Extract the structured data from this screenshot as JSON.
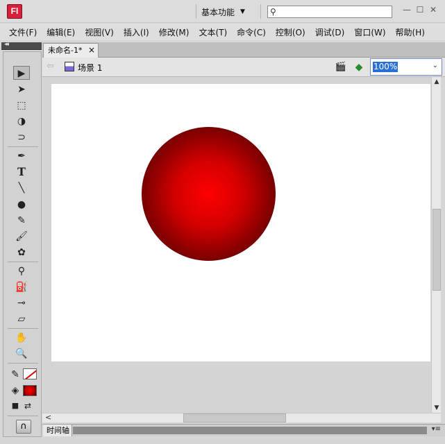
{
  "app": {
    "logo": "Fl",
    "workspace_label": "基本功能",
    "workspace_caret": "▼",
    "search_icon": "⚲",
    "minimize": "—",
    "maximize": "☐",
    "close": "✕"
  },
  "menu": [
    "文件(F)",
    "编辑(E)",
    "视图(V)",
    "插入(I)",
    "修改(M)",
    "文本(T)",
    "命令(C)",
    "控制(O)",
    "调试(D)",
    "窗口(W)",
    "帮助(H)"
  ],
  "tools_panel": {
    "collapse": "◂◂",
    "icons": {
      "selection": "▶",
      "subselection": "➤",
      "free_transform": "⬚",
      "3d_rotation": "◑",
      "lasso": "⊃",
      "pen": "✒",
      "text": "T",
      "line": "╲",
      "oval": "●",
      "pencil": "✎",
      "brush": "🖌",
      "deco": "✿",
      "bone": "⚲",
      "paint_bucket": "⛽",
      "eyedropper": "⊸",
      "eraser": "▱",
      "hand": "✋",
      "zoom": "🔍",
      "stroke": "✎",
      "fill": "◈",
      "swap": "⇄",
      "snap": "∩"
    }
  },
  "document": {
    "tab_title": "未命名-1*",
    "tab_close": "×",
    "scene_label": "场景 1",
    "back_arrow": "⇦",
    "zoom": "100%",
    "zoom_caret": "⌄"
  },
  "colors": {
    "fill_center": "#ff0000",
    "fill_edge": "#1a0000",
    "stage": "#ffffff",
    "selection_highlight": "#2a6fd6"
  },
  "scrollbars": {
    "up": "▲",
    "down": "▼",
    "left": "<"
  },
  "timeline": {
    "tab_label": "时间轴",
    "menu_icon": "▾≡"
  }
}
